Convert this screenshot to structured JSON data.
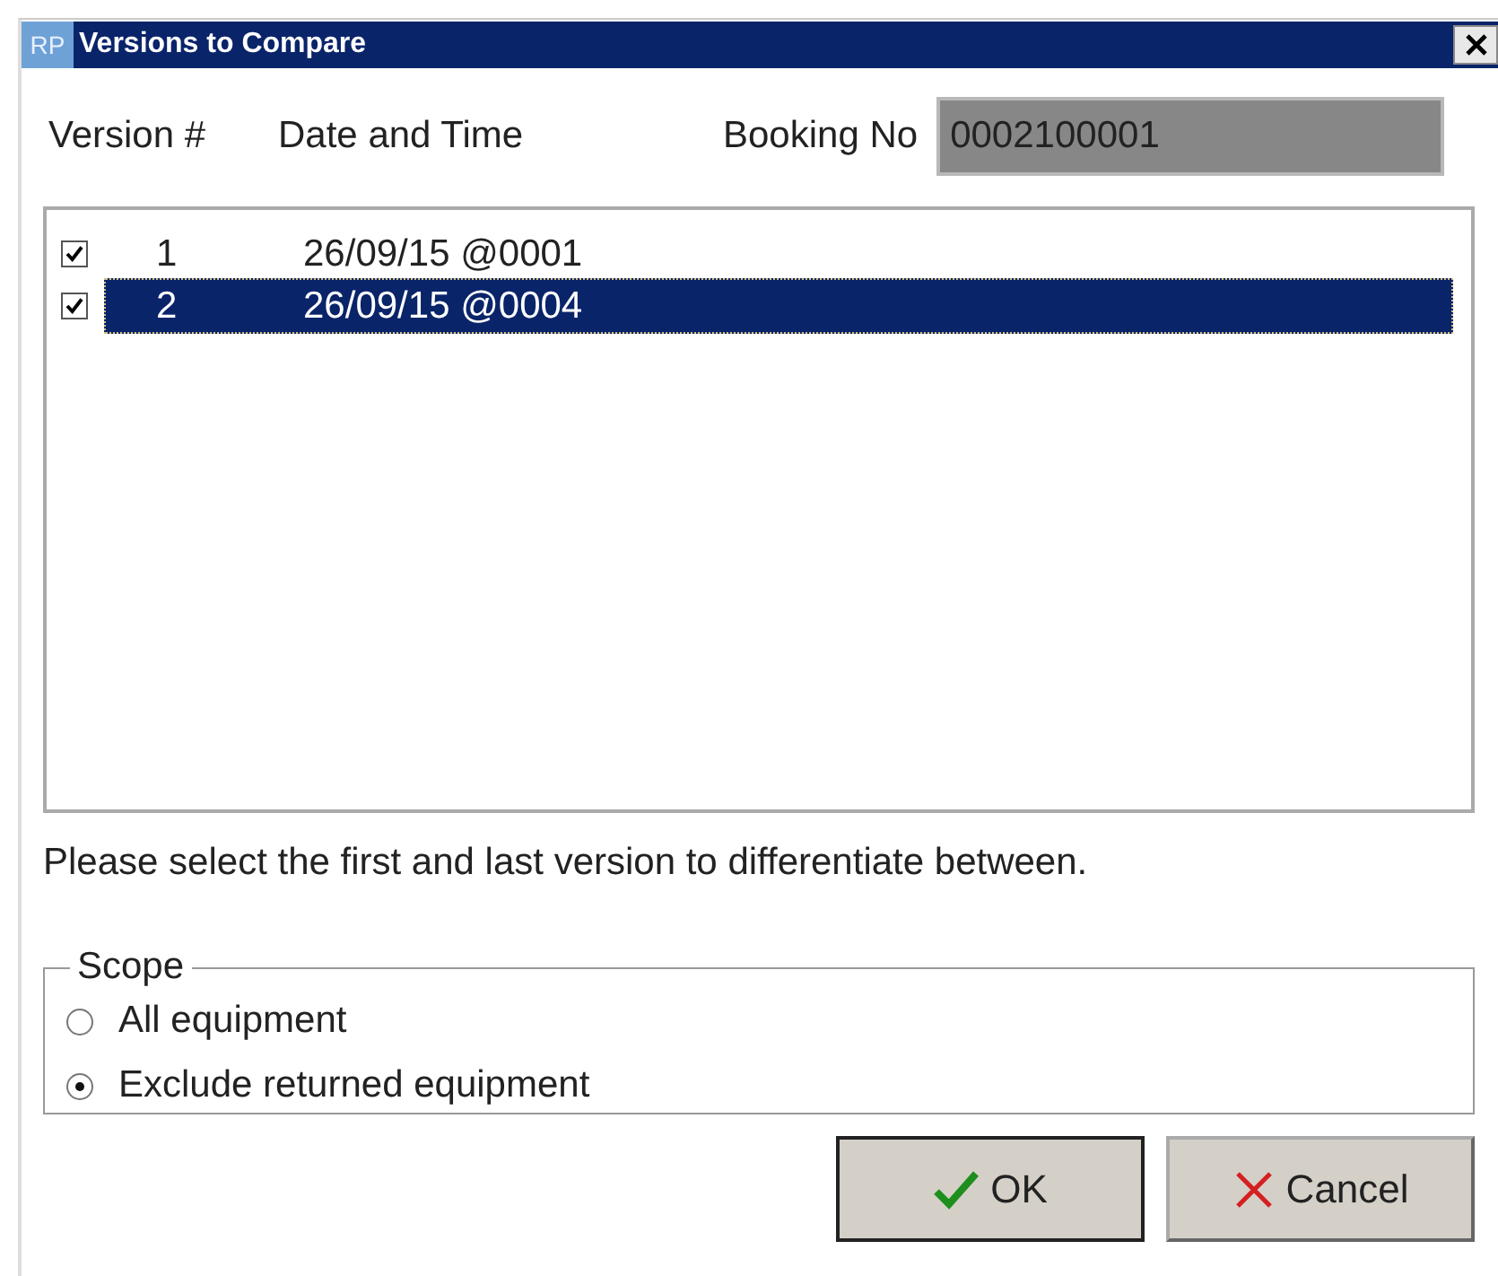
{
  "window": {
    "icon_text": "RP",
    "title": "Versions to Compare"
  },
  "columns": [
    "Version #",
    "Date and Time"
  ],
  "booking": {
    "label": "Booking No",
    "value": "0002100001"
  },
  "versions": [
    {
      "number": "1",
      "datetime": "26/09/15 @0001",
      "checked": true,
      "selected": false
    },
    {
      "number": "2",
      "datetime": "26/09/15 @0004",
      "checked": true,
      "selected": true
    }
  ],
  "instruction": "Please select the first and last version to differentiate between.",
  "scope": {
    "title": "Scope",
    "options": [
      {
        "label": "All equipment",
        "selected": false
      },
      {
        "label": "Exclude returned equipment",
        "selected": true
      }
    ]
  },
  "buttons": [
    {
      "kind": "ok",
      "label": "OK"
    },
    {
      "kind": "cancel",
      "label": "Cancel"
    }
  ]
}
